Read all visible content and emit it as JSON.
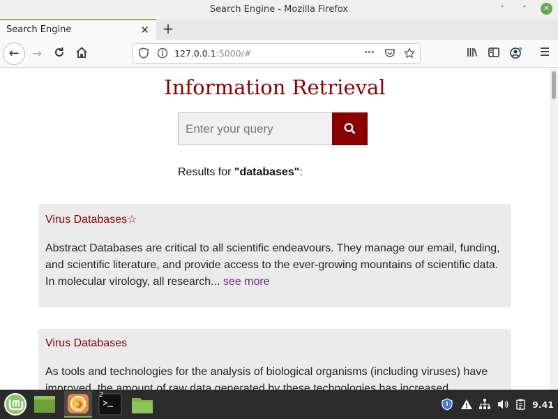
{
  "window": {
    "title": "Search Engine - Mozilla Firefox",
    "minimize_icon": "˅",
    "maximize_icon": "˄",
    "close_icon": "✕"
  },
  "tab": {
    "label": "Search Engine",
    "close_icon": "✕",
    "new_tab_icon": "+"
  },
  "navbar": {
    "url_host": "127.0.0.1",
    "url_rest": ":5000/#",
    "more_icon": "•••"
  },
  "page": {
    "heading": "Information Retrieval",
    "search_placeholder": "Enter your query",
    "results_prefix": "Results for ",
    "results_query": "\"databases\"",
    "results_suffix": ":",
    "results": [
      {
        "title": "Virus Databases☆",
        "body": "Abstract Databases are critical to all scientific endeavours. They manage our email, funding, and scientific literature, and provide access to the ever-growing mountains of scientific data. In molecular virology, all research...",
        "see_more": "see more"
      },
      {
        "title": "Virus Databases",
        "body": "As tools and technologies for the analysis of biological organisms (including viruses) have improved, the amount of raw data generated by these technologies has increased"
      }
    ]
  },
  "taskbar": {
    "terminal_badge": "2",
    "clock": "9.41"
  },
  "colors": {
    "accent": "#8b0000",
    "link_visited": "#7a1f8c",
    "tab_indicator": "#7fb446"
  }
}
